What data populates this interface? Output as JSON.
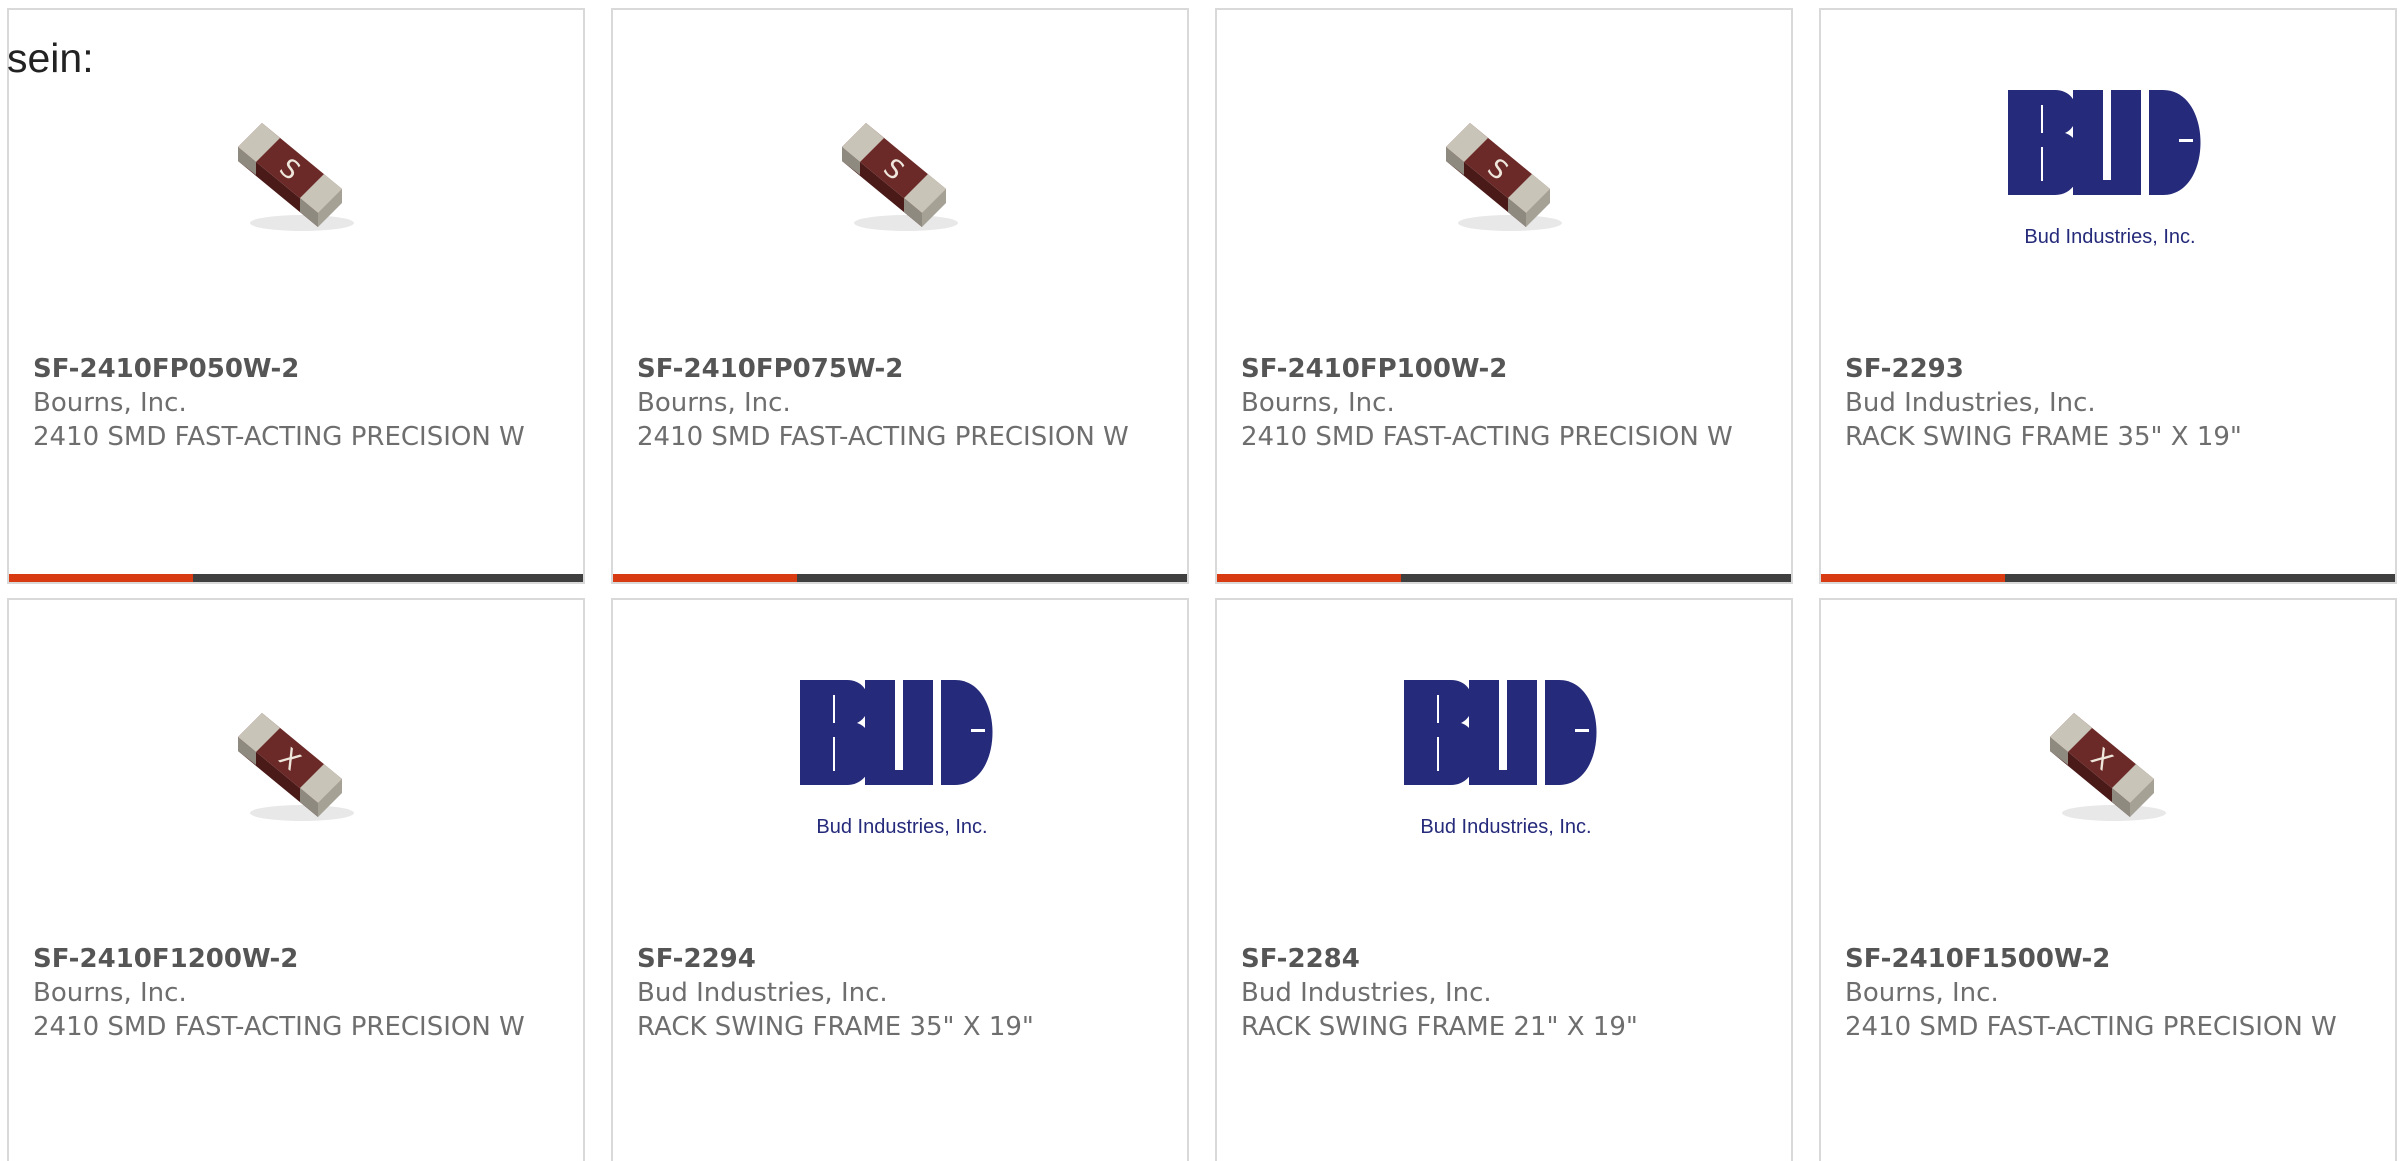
{
  "intro_text": "sein:",
  "colors": {
    "accent": "#d83a12",
    "bar": "#3f3f3f",
    "bud_logo_blue": "#252a7a",
    "fuse_body": "#6b2a28",
    "text": "#6e6e6e"
  },
  "products": [
    {
      "part_number": "SF-2410FP050W-2",
      "manufacturer": "Bourns, Inc.",
      "description": "2410 SMD FAST-ACTING PRECISION W",
      "image": "fuse-chip",
      "marking": "S",
      "accent_fraction": 0.32
    },
    {
      "part_number": "SF-2410FP075W-2",
      "manufacturer": "Bourns, Inc.",
      "description": "2410 SMD FAST-ACTING PRECISION W",
      "image": "fuse-chip",
      "marking": "S",
      "accent_fraction": 0.32
    },
    {
      "part_number": "SF-2410FP100W-2",
      "manufacturer": "Bourns, Inc.",
      "description": "2410 SMD FAST-ACTING PRECISION W",
      "image": "fuse-chip",
      "marking": "S",
      "accent_fraction": 0.32
    },
    {
      "part_number": "SF-2293",
      "manufacturer": "Bud Industries, Inc.",
      "description": "RACK SWING FRAME 35\" X 19\"",
      "image": "bud-logo",
      "logo_text": "Bud Industries, Inc.",
      "accent_fraction": 0.32
    },
    {
      "part_number": "SF-2410F1200W-2",
      "manufacturer": "Bourns, Inc.",
      "description": "2410 SMD FAST-ACTING PRECISION W",
      "image": "fuse-chip",
      "marking": "X",
      "accent_fraction": 0.32
    },
    {
      "part_number": "SF-2294",
      "manufacturer": "Bud Industries, Inc.",
      "description": "RACK SWING FRAME 35\" X 19\"",
      "image": "bud-logo",
      "logo_text": "Bud Industries, Inc.",
      "accent_fraction": 0.32
    },
    {
      "part_number": "SF-2284",
      "manufacturer": "Bud Industries, Inc.",
      "description": "RACK SWING FRAME 21\" X 19\"",
      "image": "bud-logo",
      "logo_text": "Bud Industries, Inc.",
      "accent_fraction": 0.32
    },
    {
      "part_number": "SF-2410F1500W-2",
      "manufacturer": "Bourns, Inc.",
      "description": "2410 SMD FAST-ACTING PRECISION W",
      "image": "fuse-chip",
      "marking": "X",
      "accent_fraction": 0.32
    }
  ]
}
